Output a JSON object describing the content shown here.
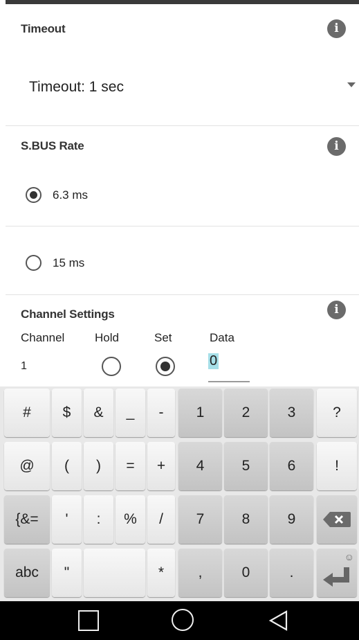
{
  "timeout": {
    "heading": "Timeout",
    "dropdown_value": "Timeout: 1 sec",
    "info_icon": "info-icon"
  },
  "sbus": {
    "heading": "S.BUS Rate",
    "options": [
      {
        "label": "6.3 ms",
        "checked": true
      },
      {
        "label": "15 ms",
        "checked": false
      }
    ]
  },
  "channel": {
    "heading": "Channel Settings",
    "columns": [
      "Channel",
      "Hold",
      "Set",
      "Data"
    ],
    "row": {
      "channel": "1",
      "hold": false,
      "set": true,
      "data": "0"
    }
  },
  "keyboard": {
    "rows": [
      [
        "#",
        "$",
        "&",
        "_",
        "-",
        "1",
        "2",
        "3",
        "?"
      ],
      [
        "@",
        "(",
        ")",
        "=",
        "+",
        "4",
        "5",
        "6",
        "!"
      ],
      [
        "{&=",
        "'",
        ":",
        "%",
        "/",
        "7",
        "8",
        "9",
        "backspace-icon"
      ],
      [
        "abc",
        "\"",
        "",
        "*",
        ",",
        "0",
        ".",
        "enter-icon"
      ]
    ],
    "smiley": "☺"
  },
  "nav": {
    "recent": "square-icon",
    "home": "circle-icon",
    "back": "triangle-back-icon"
  }
}
